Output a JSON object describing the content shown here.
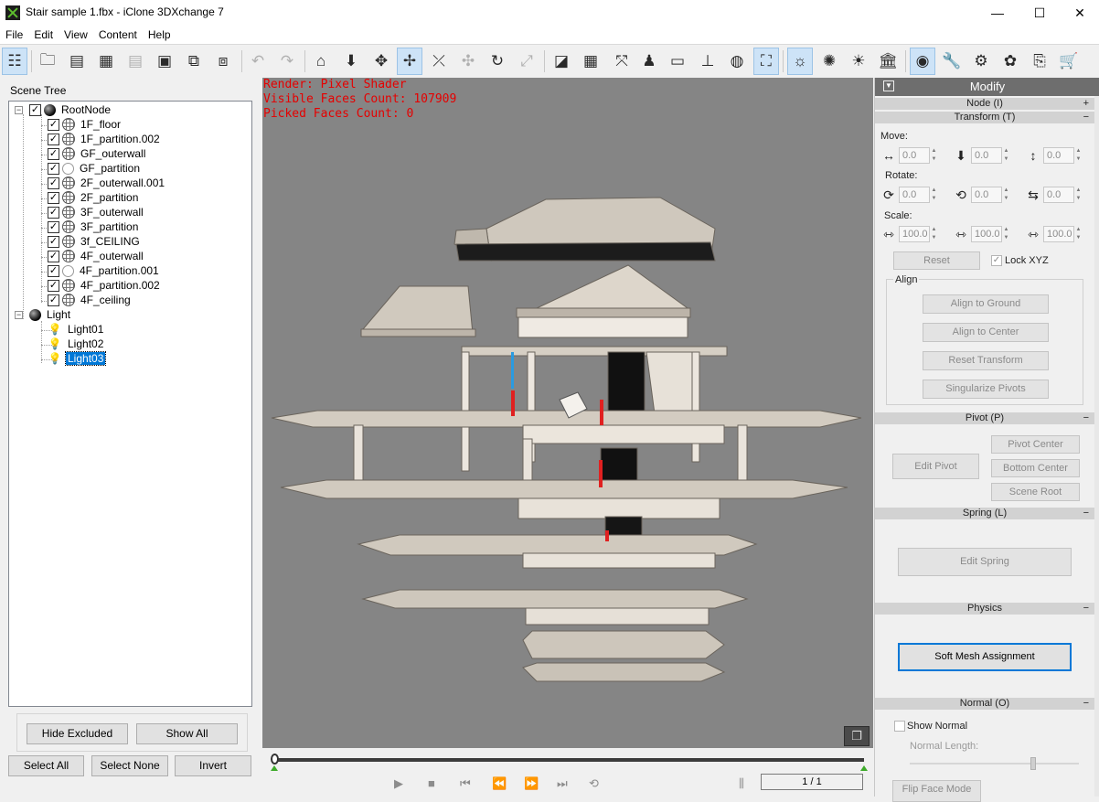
{
  "window": {
    "title": "Stair sample 1.fbx - iClone 3DXchange 7",
    "min": "—",
    "max": "☐",
    "close": "✕"
  },
  "menu": [
    "File",
    "Edit",
    "View",
    "Content",
    "Help"
  ],
  "toolbar_icons": [
    "scene-tree-icon",
    "open-folder-icon",
    "import-ic-icon",
    "import-fbx-icon",
    "import-bvh-icon",
    "import-obj-icon",
    "export-icon",
    "convert-icon",
    "undo-icon",
    "redo-icon",
    "home-icon",
    "drop-to-ground-icon",
    "move-icon",
    "rotate-icon",
    "pick-icon",
    "pan-icon",
    "orbit-icon",
    "zoom-extent-icon",
    "render-mode-icon",
    "grid-icon",
    "axis-icon",
    "person-icon",
    "box-icon",
    "ground-icon",
    "globe-icon",
    "fit-view-icon",
    "light-icon",
    "spotlight-icon",
    "sun-icon",
    "building-icon",
    "sphere-icon",
    "wrench-icon",
    "character-settings-icon",
    "expression-icon",
    "export-fbx-icon",
    "cart-icon"
  ],
  "scene_tree": {
    "heading": "Scene Tree",
    "root": "RootNode",
    "children": [
      "1F_floor",
      "1F_partition.002",
      "GF_outerwall",
      "GF_partition",
      "2F_outerwall.001",
      "2F_partition",
      "3F_outerwall",
      "3F_partition",
      "3f_CEILING",
      "4F_outerwall",
      "4F_partition.001",
      "4F_partition.002",
      "4F_ceiling"
    ],
    "light_group": "Light",
    "lights": [
      "Light01",
      "Light02",
      "Light03"
    ],
    "selected": "Light03",
    "buttons": {
      "hide_excluded": "Hide Excluded",
      "show_all": "Show All",
      "select_all": "Select All",
      "select_none": "Select None",
      "invert": "Invert"
    }
  },
  "viewport": {
    "render": "Render: Pixel Shader",
    "visible_faces": "Visible Faces Count: 107909",
    "picked_faces": "Picked Faces Count: 0"
  },
  "timeline": {
    "frame": "1 / 1",
    "progress": 0
  },
  "modify": {
    "title": "Modify",
    "sections": {
      "node": "Node (I)",
      "transform": "Transform (T)",
      "pivot": "Pivot (P)",
      "spring": "Spring (L)",
      "physics": "Physics",
      "normal": "Normal (O)"
    },
    "move_label": "Move:",
    "move": [
      "0.0",
      "0.0",
      "0.0"
    ],
    "rotate_label": "Rotate:",
    "rotate": [
      "0.0",
      "0.0",
      "0.0"
    ],
    "scale_label": "Scale:",
    "scale": [
      "100.0",
      "100.0",
      "100.0"
    ],
    "reset": "Reset",
    "lock_xyz": "Lock XYZ",
    "align_label": "Align",
    "align_to_ground": "Align to Ground",
    "align_to_center": "Align to Center",
    "reset_transform": "Reset Transform",
    "singularize_pivots": "Singularize Pivots",
    "edit_pivot": "Edit Pivot",
    "pivot_center": "Pivot Center",
    "bottom_center": "Bottom Center",
    "scene_root": "Scene Root",
    "edit_spring": "Edit Spring",
    "soft_mesh_assignment": "Soft Mesh Assignment",
    "show_normal": "Show Normal",
    "normal_length": "Normal Length:",
    "flip_face_mode": "Flip Face Mode"
  },
  "colors": {
    "viewport_bg": "#858585",
    "stats_text": "#e60000",
    "selection": "#0078d7",
    "model": "#d8d1c6"
  }
}
